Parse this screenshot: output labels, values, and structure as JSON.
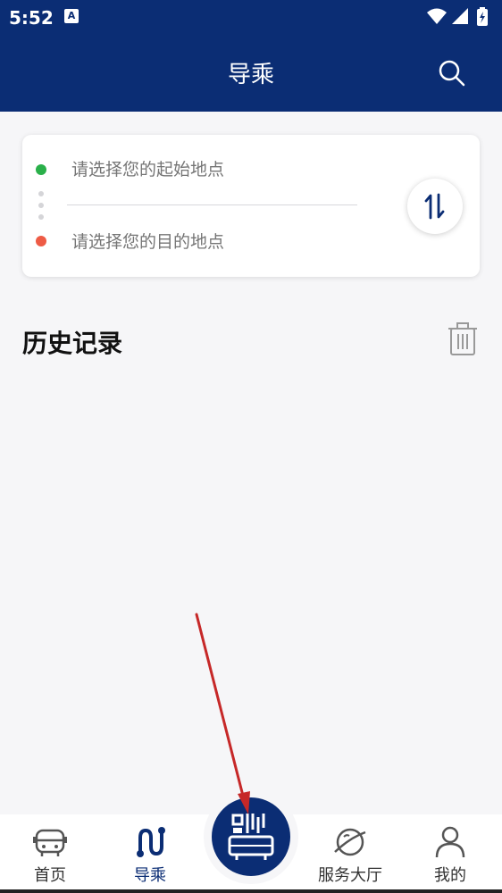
{
  "status_bar": {
    "time": "5:52",
    "notification_badge": "A"
  },
  "header": {
    "title": "导乘"
  },
  "route": {
    "start_placeholder": "请选择您的起始地点",
    "end_placeholder": "请选择您的目的地点"
  },
  "history": {
    "title": "历史记录"
  },
  "tabbar": {
    "items": [
      {
        "label": "首页",
        "icon": "bus-icon"
      },
      {
        "label": "导乘",
        "icon": "route-icon",
        "active": true
      },
      {
        "label": "",
        "icon": "qr-bus-icon",
        "center": true
      },
      {
        "label": "服务大厅",
        "icon": "planet-icon"
      },
      {
        "label": "我的",
        "icon": "user-icon"
      }
    ]
  },
  "colors": {
    "primary": "#0b2d74",
    "start_dot": "#2ab04a",
    "end_dot": "#ee5b45",
    "annotation_arrow": "#c62828"
  }
}
